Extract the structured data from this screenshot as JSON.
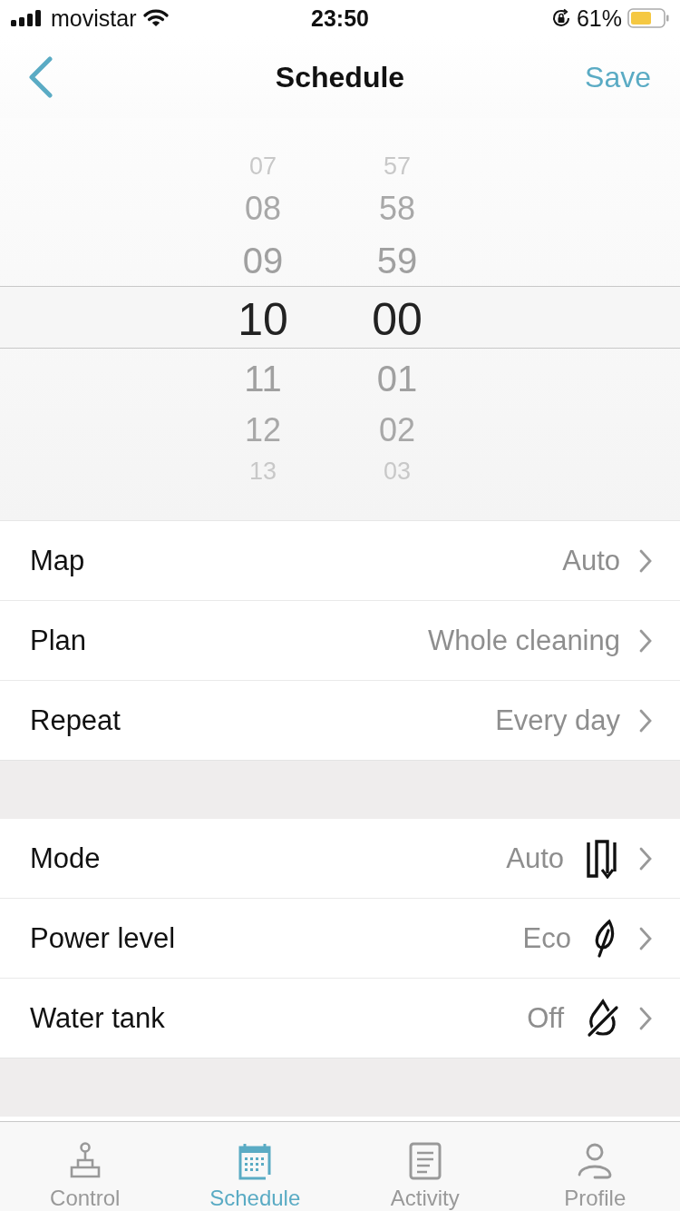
{
  "status_bar": {
    "carrier": "movistar",
    "time": "23:50",
    "battery": "61%"
  },
  "nav": {
    "title": "Schedule",
    "action": "Save"
  },
  "picker": {
    "columns": [
      {
        "items": [
          {
            "label": "07",
            "selected": false
          },
          {
            "label": "08",
            "selected": false
          },
          {
            "label": "09",
            "selected": false
          },
          {
            "label": "10",
            "selected": true
          },
          {
            "label": "11",
            "selected": false
          },
          {
            "label": "12",
            "selected": false
          },
          {
            "label": "13",
            "selected": false
          }
        ]
      },
      {
        "items": [
          {
            "label": "57",
            "selected": false
          },
          {
            "label": "58",
            "selected": false
          },
          {
            "label": "59",
            "selected": false
          },
          {
            "label": "00",
            "selected": true
          },
          {
            "label": "01",
            "selected": false
          },
          {
            "label": "02",
            "selected": false
          },
          {
            "label": "03",
            "selected": false
          }
        ]
      }
    ]
  },
  "sections": [
    {
      "rows": [
        {
          "label": "Map",
          "value": "Auto",
          "kind": "plain"
        },
        {
          "label": "Plan",
          "value": "Whole cleaning",
          "kind": "plain"
        },
        {
          "label": "Repeat",
          "value": "Every day",
          "kind": "plain"
        }
      ]
    },
    {
      "rows": [
        {
          "label": "Mode",
          "value": "Auto",
          "kind": "icon"
        },
        {
          "label": "Power level",
          "value": "Eco",
          "kind": "icon"
        },
        {
          "label": "Water tank",
          "value": "Off",
          "kind": "icon"
        }
      ]
    }
  ],
  "tabs": [
    {
      "label": "Control",
      "selected": false
    },
    {
      "label": "Schedule",
      "selected": true
    },
    {
      "label": "Activity",
      "selected": false
    },
    {
      "label": "Profile",
      "selected": false
    }
  ]
}
